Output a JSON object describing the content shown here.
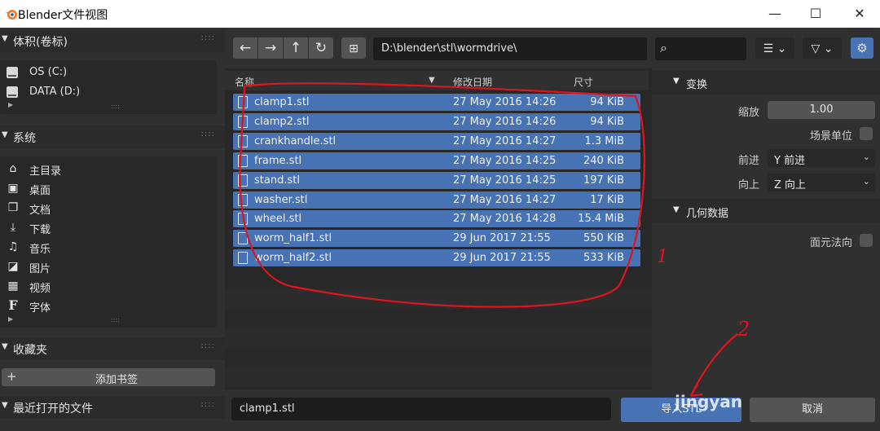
{
  "window": {
    "title": "Blender文件视图"
  },
  "sidebar": {
    "volumes": {
      "title": "体积(卷标)",
      "items": [
        {
          "label": "OS (C:)"
        },
        {
          "label": "DATA (D:)"
        }
      ]
    },
    "system": {
      "title": "系统",
      "items": [
        {
          "label": "主目录",
          "icon": "home-icon"
        },
        {
          "label": "桌面",
          "icon": "desktop-icon"
        },
        {
          "label": "文档",
          "icon": "documents-icon"
        },
        {
          "label": "下载",
          "icon": "download-icon"
        },
        {
          "label": "音乐",
          "icon": "music-icon"
        },
        {
          "label": "图片",
          "icon": "picture-icon"
        },
        {
          "label": "视频",
          "icon": "video-icon"
        },
        {
          "label": "字体",
          "icon": "font-icon"
        }
      ]
    },
    "bookmarks": {
      "title": "收藏夹",
      "add_label": "添加书签"
    },
    "recent": {
      "title": "最近打开的文件"
    }
  },
  "toolbar": {
    "path": "D:\\blender\\stl\\wormdrive\\"
  },
  "filelist": {
    "headers": {
      "name": "名称",
      "date": "修改日期",
      "size": "尺寸"
    },
    "files": [
      {
        "name": "clamp1.stl",
        "date": "27 May 2016 14:26",
        "size": "94 KiB"
      },
      {
        "name": "clamp2.stl",
        "date": "27 May 2016 14:26",
        "size": "94 KiB"
      },
      {
        "name": "crankhandle.stl",
        "date": "27 May 2016 14:27",
        "size": "1.3 MiB"
      },
      {
        "name": "frame.stl",
        "date": "27 May 2016 14:25",
        "size": "240 KiB"
      },
      {
        "name": "stand.stl",
        "date": "27 May 2016 14:25",
        "size": "197 KiB"
      },
      {
        "name": "washer.stl",
        "date": "27 May 2016 14:27",
        "size": "17 KiB"
      },
      {
        "name": "wheel.stl",
        "date": "27 May 2016 14:28",
        "size": "15.4 MiB"
      },
      {
        "name": "worm_half1.stl",
        "date": "29 Jun 2017 21:55",
        "size": "550 KiB"
      },
      {
        "name": "worm_half2.stl",
        "date": "29 Jun 2017 21:55",
        "size": "533 KiB"
      }
    ]
  },
  "options": {
    "transform": {
      "title": "变换",
      "scale_label": "缩放",
      "scale_value": "1.00",
      "scene_unit_label": "场景单位",
      "forward_label": "前进",
      "forward_value": "Y 前进",
      "up_label": "向上",
      "up_value": "Z 向上"
    },
    "geometry": {
      "title": "几何数据",
      "face_normals_label": "面元法向"
    }
  },
  "footer": {
    "filename": "clamp1.stl",
    "import_label": "导入STL",
    "cancel_label": "取消"
  },
  "annotations": {
    "mark1": "1",
    "mark2": "2",
    "watermark": "jingyan"
  },
  "colors": {
    "selection": "#4772b3",
    "annotation": "#e0141e",
    "panel": "#303030"
  }
}
